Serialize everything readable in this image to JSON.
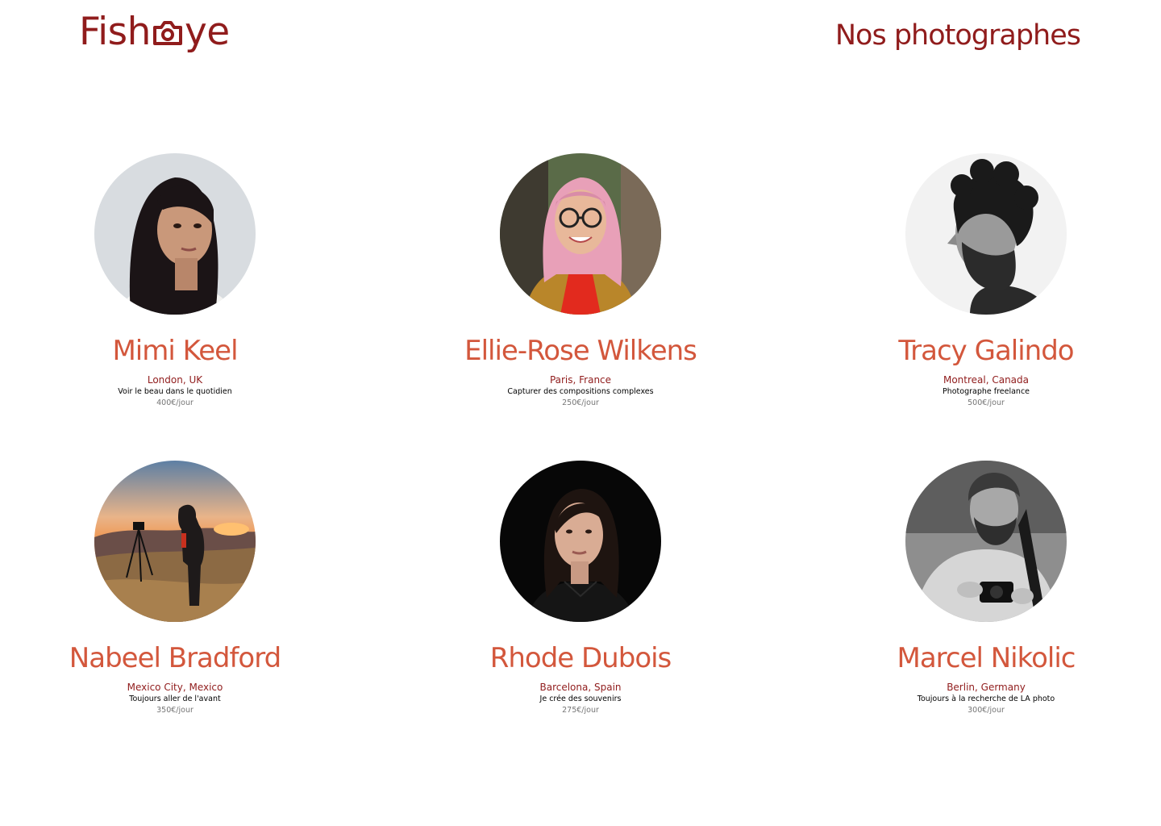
{
  "header": {
    "logo_text_left": "Fish",
    "logo_text_right": "ye",
    "logo_icon": "camera-icon",
    "title": "Nos photographes"
  },
  "colors": {
    "primary": "#901C1C",
    "secondary": "#D3573C",
    "price_gray": "#757575"
  },
  "photographers": [
    {
      "name": "Mimi Keel",
      "location": "London, UK",
      "tagline": "Voir le beau dans le quotidien",
      "price": "400€/jour"
    },
    {
      "name": "Ellie-Rose Wilkens",
      "location": "Paris, France",
      "tagline": "Capturer des compositions complexes",
      "price": "250€/jour"
    },
    {
      "name": "Tracy Galindo",
      "location": "Montreal, Canada",
      "tagline": "Photographe freelance",
      "price": "500€/jour"
    },
    {
      "name": "Nabeel Bradford",
      "location": "Mexico City, Mexico",
      "tagline": "Toujours aller de l'avant",
      "price": "350€/jour"
    },
    {
      "name": "Rhode Dubois",
      "location": "Barcelona, Spain",
      "tagline": "Je crée des souvenirs",
      "price": "275€/jour"
    },
    {
      "name": "Marcel Nikolic",
      "location": "Berlin, Germany",
      "tagline": "Toujours à la recherche de LA photo",
      "price": "300€/jour"
    }
  ]
}
